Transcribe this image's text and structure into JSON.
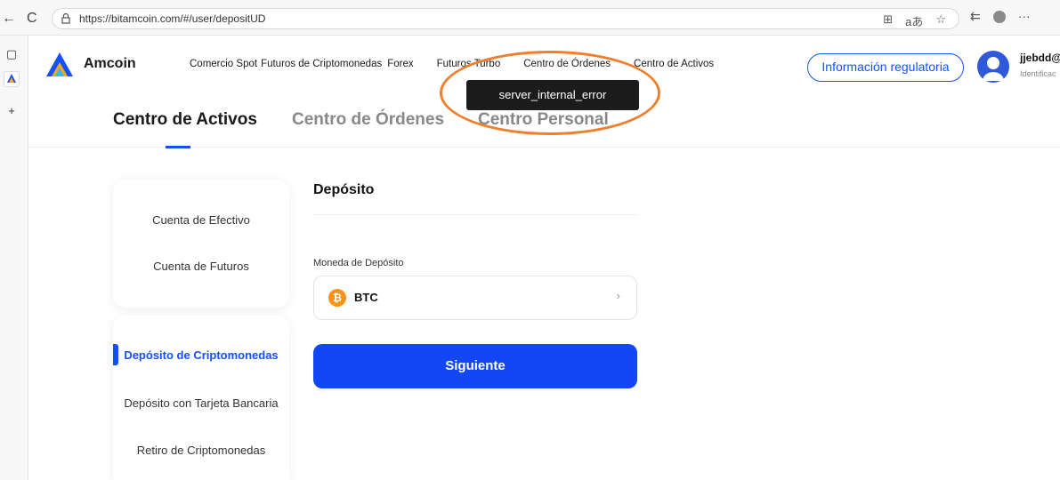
{
  "browser": {
    "url": "https://bitamcoin.com/#/user/depositUD",
    "back": "←",
    "reload": "C",
    "icons_right": [
      "⊞",
      "aあ",
      "☆",
      "⇇",
      "···"
    ]
  },
  "header": {
    "brand": "Amcoin",
    "nav": [
      "Comercio Spot",
      "Futuros de Criptomonedas",
      "Forex",
      "Futuros Turbo",
      "Centro de Órdenes",
      "Centro de Activos"
    ],
    "regulatory_button": "Información regulatoria",
    "user_name": "jjebdd@",
    "user_sub": "Identificac"
  },
  "tooltip": "server_internal_error",
  "subtabs": [
    "Centro de Activos",
    "Centro de Órdenes",
    "Centro Personal"
  ],
  "account_panel": [
    "Cuenta de Efectivo",
    "Cuenta de Futuros"
  ],
  "action_panel": [
    "Depósito de Criptomonedas",
    "Depósito con Tarjeta Bancaria",
    "Retiro de Criptomonedas"
  ],
  "deposit": {
    "title": "Depósito",
    "currency_label": "Moneda de Depósito",
    "currency": "BTC",
    "coin_symbol": "₿",
    "chevron": "›",
    "next_button": "Siguiente"
  },
  "colors": {
    "accent": "#1451f5",
    "annotation": "#ef7f2d",
    "btc": "#f7931a"
  }
}
